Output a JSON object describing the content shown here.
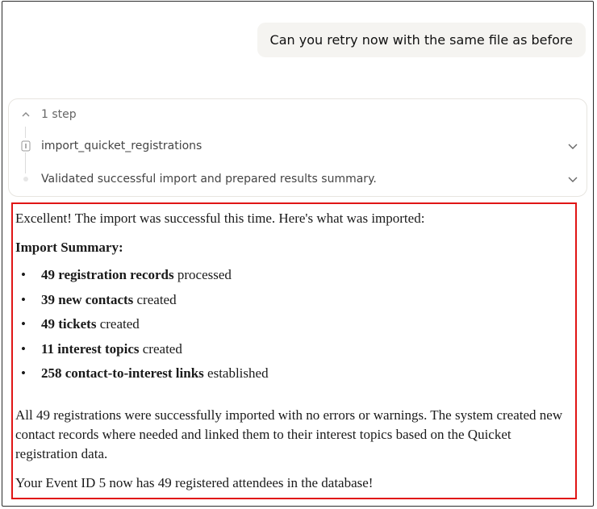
{
  "user_message": "Can you retry now with the same file as before",
  "steps": {
    "count_label": "1 step",
    "items": [
      {
        "label": "import_quicket_registrations"
      },
      {
        "label": "Validated successful import and prepared results summary."
      }
    ]
  },
  "response": {
    "intro": "Excellent! The import was successful this time. Here's what was imported:",
    "heading": "Import Summary:",
    "bullets": [
      {
        "bold": "49 registration records",
        "rest": " processed"
      },
      {
        "bold": "39 new contacts",
        "rest": " created"
      },
      {
        "bold": "49 tickets",
        "rest": " created"
      },
      {
        "bold": "11 interest topics",
        "rest": " created"
      },
      {
        "bold": "258 contact-to-interest links",
        "rest": " established"
      }
    ],
    "paragraph": "All 49 registrations were successfully imported with no errors or warnings. The system created new contact records where needed and linked them to their interest topics based on the Quicket registration data.",
    "final": "Your Event ID 5 now has 49 registered attendees in the database!"
  },
  "colors": {
    "highlight_border": "#e01515",
    "bubble_bg": "#f5f4f1"
  }
}
